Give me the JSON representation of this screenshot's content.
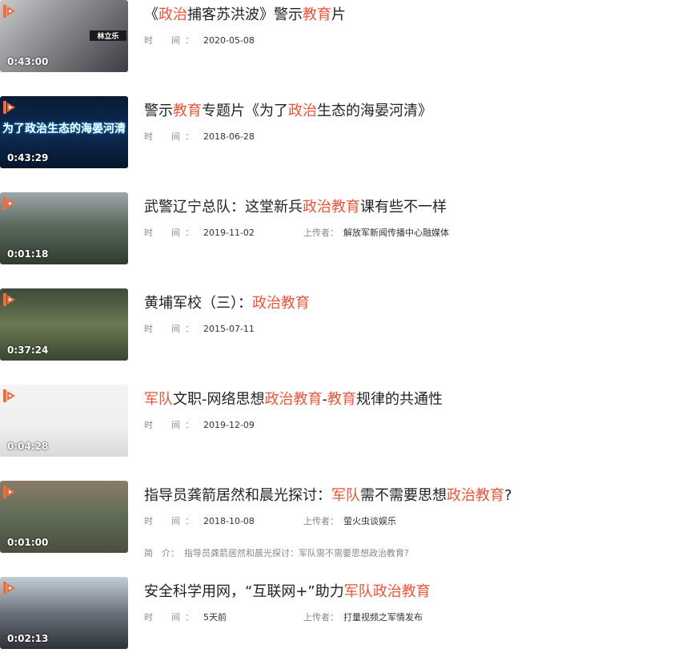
{
  "labels": {
    "time": "时　间：",
    "uploader": "上传者：",
    "intro": "简　介："
  },
  "colors": {
    "highlight": "#e8553a",
    "logo": "#f26d3d"
  },
  "videos": [
    {
      "title_parts": [
        [
          "《",
          0
        ],
        [
          "政治",
          1
        ],
        [
          "捕客苏洪波》警示",
          0
        ],
        [
          "教育",
          1
        ],
        [
          "片",
          0
        ]
      ],
      "duration": "0:43:00",
      "date": "2020-05-08",
      "uploader": "",
      "intro": "",
      "thumb_caption": "林立乐"
    },
    {
      "title_parts": [
        [
          "警示",
          0
        ],
        [
          "教育",
          1
        ],
        [
          "专题片《为了",
          0
        ],
        [
          "政治",
          1
        ],
        [
          "生态的海晏河清》",
          0
        ]
      ],
      "duration": "0:43:29",
      "date": "2018-06-28",
      "uploader": "",
      "intro": "",
      "thumb_caption": "为了政治生态的海晏河清"
    },
    {
      "title_parts": [
        [
          "武警辽宁总队：这堂新兵",
          0
        ],
        [
          "政治教育",
          1
        ],
        [
          "课有些不一样",
          0
        ]
      ],
      "duration": "0:01:18",
      "date": "2019-11-02",
      "uploader": "解放军新闻传播中心融媒体",
      "intro": "",
      "thumb_caption": ""
    },
    {
      "title_parts": [
        [
          "黄埔军校（三）：",
          0
        ],
        [
          "政治教育",
          1
        ]
      ],
      "duration": "0:37:24",
      "date": "2015-07-11",
      "uploader": "",
      "intro": "",
      "thumb_caption": ""
    },
    {
      "title_parts": [
        [
          "军队",
          1
        ],
        [
          "文职-网络思想",
          0
        ],
        [
          "政治教育",
          1
        ],
        [
          "-",
          0
        ],
        [
          "教育",
          1
        ],
        [
          "规律的共通性",
          0
        ]
      ],
      "duration": "0:04:28",
      "date": "2019-12-09",
      "uploader": "",
      "intro": "",
      "thumb_caption": ""
    },
    {
      "title_parts": [
        [
          "指导员龚箭居然和晨光探讨：",
          0
        ],
        [
          "军队",
          1
        ],
        [
          "需不需要思想",
          0
        ],
        [
          "政治教育",
          1
        ],
        [
          "?",
          0
        ]
      ],
      "duration": "0:01:00",
      "date": "2018-10-08",
      "uploader": "萤火虫谈娱乐",
      "intro": "指导员龚箭居然和晨光探讨：军队需不需要思想政治教育?",
      "thumb_caption": ""
    },
    {
      "title_parts": [
        [
          "安全科学用网，“互联网+”助力",
          0
        ],
        [
          "军队政治教育",
          1
        ]
      ],
      "duration": "0:02:13",
      "date": "5天前",
      "uploader": "打量视频之军情发布",
      "intro": "",
      "thumb_caption": ""
    }
  ]
}
